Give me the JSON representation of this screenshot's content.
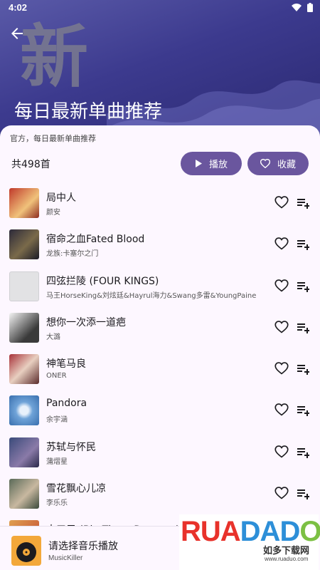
{
  "status_bar": {
    "time": "4:02"
  },
  "header": {
    "big_char": "新",
    "title": "每日最新单曲推荐"
  },
  "playlist": {
    "description": "官方，每日最新单曲推荐",
    "count": "共498首",
    "play_label": "播放",
    "favorite_label": "收藏"
  },
  "songs": [
    {
      "title": "局中人",
      "artist": "颜安"
    },
    {
      "title": "宿命之血Fated Blood",
      "artist": "龙族:卡塞尔之门"
    },
    {
      "title": "四弦拦陵 (FOUR KINGS)",
      "artist": "马王HorseKing&刘炫廷&Hayrul海力&Swang多雷&YoungPaine"
    },
    {
      "title": "想你一次添一道疤",
      "artist": "大潞"
    },
    {
      "title": "神笔马良",
      "artist": "ONER"
    },
    {
      "title": "Pandora",
      "artist": "余宇涵"
    },
    {
      "title": "苏轼与怀民",
      "artist": "蒲熠星"
    },
    {
      "title": "雪花飘心儿凉",
      "artist": "李乐乐"
    },
    {
      "title": "大三元 (Big Three Dragons)",
      "artist": ""
    }
  ],
  "player": {
    "title": "请选择音乐播放",
    "subtitle": "MusicKiller"
  },
  "watermark": {
    "logo": "RUANDAO",
    "cn": "如多下载网",
    "url": "www.ruaduo.com"
  },
  "colors": {
    "accent": "#6a569e",
    "hero_bg": "#3c3a8e"
  }
}
